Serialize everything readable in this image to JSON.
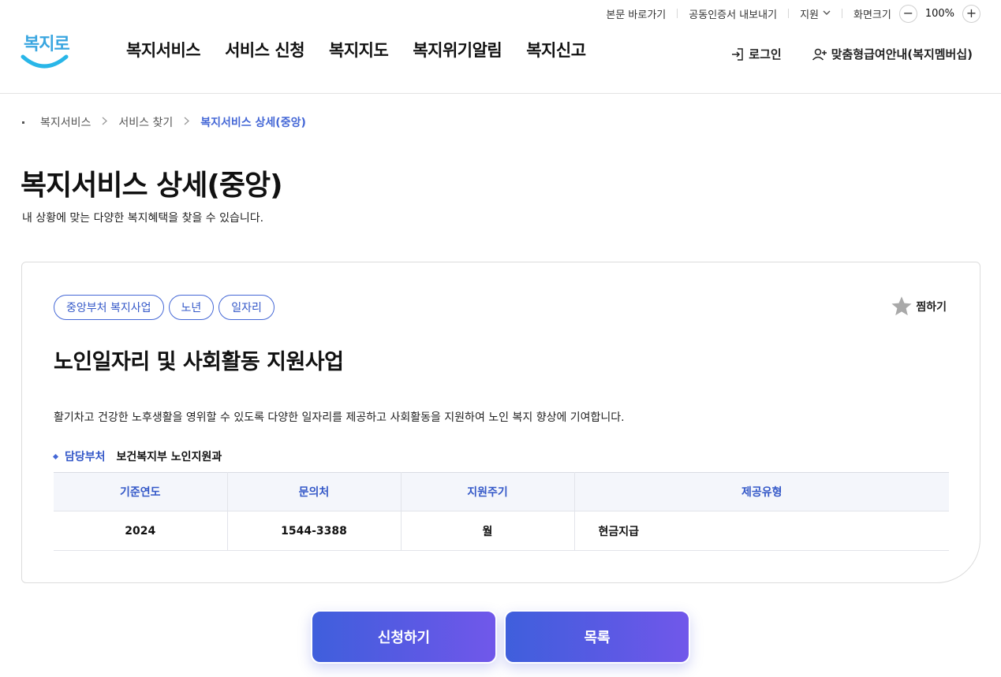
{
  "utility": {
    "skip_to_content": "본문 바로가기",
    "export_cert": "공동인증서 내보내기",
    "support": "지원",
    "screen_size": "화면크기",
    "zoom": "100%",
    "minus": "−",
    "plus": "+"
  },
  "header": {
    "logo_text": "복지로",
    "nav": [
      "복지서비스",
      "서비스 신청",
      "복지지도",
      "복지위기알림",
      "복지신고"
    ],
    "login": "로그인",
    "membership": "맞춤형급여안내(복지멤버십)"
  },
  "breadcrumb": {
    "items": [
      "복지서비스",
      "서비스 찾기"
    ],
    "current": "복지서비스 상세(중앙)",
    "sep": ">"
  },
  "page": {
    "title": "복지서비스 상세(중앙)",
    "description": "내 상황에 맞는 다양한 복지혜택을 찾을 수 있습니다."
  },
  "service": {
    "tags": [
      "중앙부처 복지사업",
      "노년",
      "일자리"
    ],
    "favorite": "찜하기",
    "title": "노인일자리 및 사회활동 지원사업",
    "description": "활기차고 건강한 노후생활을 영위할 수 있도록 다양한 일자리를 제공하고 사회활동을 지원하여 노인 복지 향상에 기여합니다.",
    "dept_label": "담당부처",
    "dept_value": "보건복지부 노인지원과",
    "table": {
      "headers": [
        "기준연도",
        "문의처",
        "지원주기",
        "제공유형"
      ],
      "row": [
        "2024",
        "1544-3388",
        "월",
        "현금지급"
      ]
    }
  },
  "actions": {
    "apply": "신청하기",
    "list": "목록"
  },
  "colors": {
    "accent": "#4467d6",
    "logo": "#3aa6e0",
    "button_start": "#3f5fdc",
    "button_end": "#7158ea"
  }
}
